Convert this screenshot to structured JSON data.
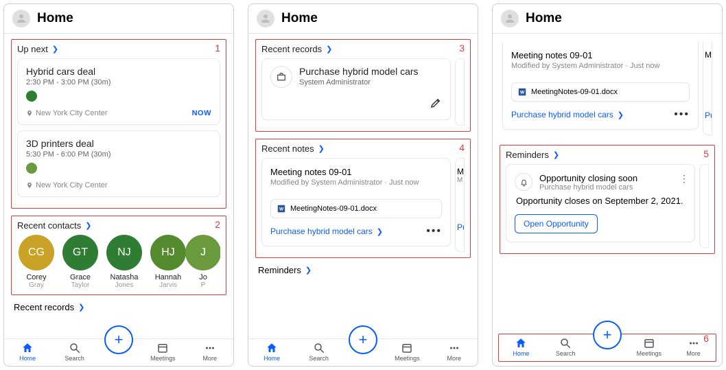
{
  "header": {
    "title": "Home"
  },
  "panels": {
    "upnext": {
      "label": "Up next",
      "num": "1",
      "items": [
        {
          "title": "Hybrid cars deal",
          "time": "2:30 PM - 3:00 PM (30m)",
          "dot": "#2e7d32",
          "loc": "New York City Center",
          "badge": "NOW"
        },
        {
          "title": "3D printers deal",
          "time": "5:30 PM - 6:00 PM (30m)",
          "dot": "#6b9a3e",
          "loc": "New York City Center"
        }
      ]
    },
    "contacts": {
      "label": "Recent contacts",
      "num": "2",
      "items": [
        {
          "initials": "CG",
          "first": "Corey",
          "last": "Gray",
          "color": "#c9a227"
        },
        {
          "initials": "GT",
          "first": "Grace",
          "last": "Taylor",
          "color": "#2e7d32"
        },
        {
          "initials": "NJ",
          "first": "Natasha",
          "last": "Jones",
          "color": "#2e7d32"
        },
        {
          "initials": "HJ",
          "first": "Hannah",
          "last": "Jarvis",
          "color": "#558b2f"
        },
        {
          "initials": "J",
          "first": "Jo",
          "last": "P",
          "color": "#6b9a3e"
        }
      ]
    },
    "records": {
      "label": "Recent records",
      "num": "3",
      "item": {
        "title": "Purchase hybrid model cars",
        "sub": "System Administrator"
      }
    },
    "notes": {
      "label": "Recent notes",
      "num": "4",
      "item": {
        "title": "Meeting notes 09-01",
        "sub": "Modified by System Administrator · Just now",
        "attachment": "MeetingNotes-09-01.docx",
        "link": "Purchase hybrid model cars"
      },
      "peek": {
        "title": "M",
        "sub": "M",
        "link": "Pu"
      }
    },
    "reminders": {
      "label": "Reminders",
      "num": "5",
      "item": {
        "title": "Opportunity closing soon",
        "sub": "Purchase hybrid model cars",
        "body": "Opportunity closes on September 2, 2021.",
        "button": "Open Opportunity"
      }
    },
    "recentrecords_peek": "Recent records"
  },
  "tabbar": {
    "num": "6",
    "home": "Home",
    "search": "Search",
    "meetings": "Meetings",
    "more": "More"
  }
}
